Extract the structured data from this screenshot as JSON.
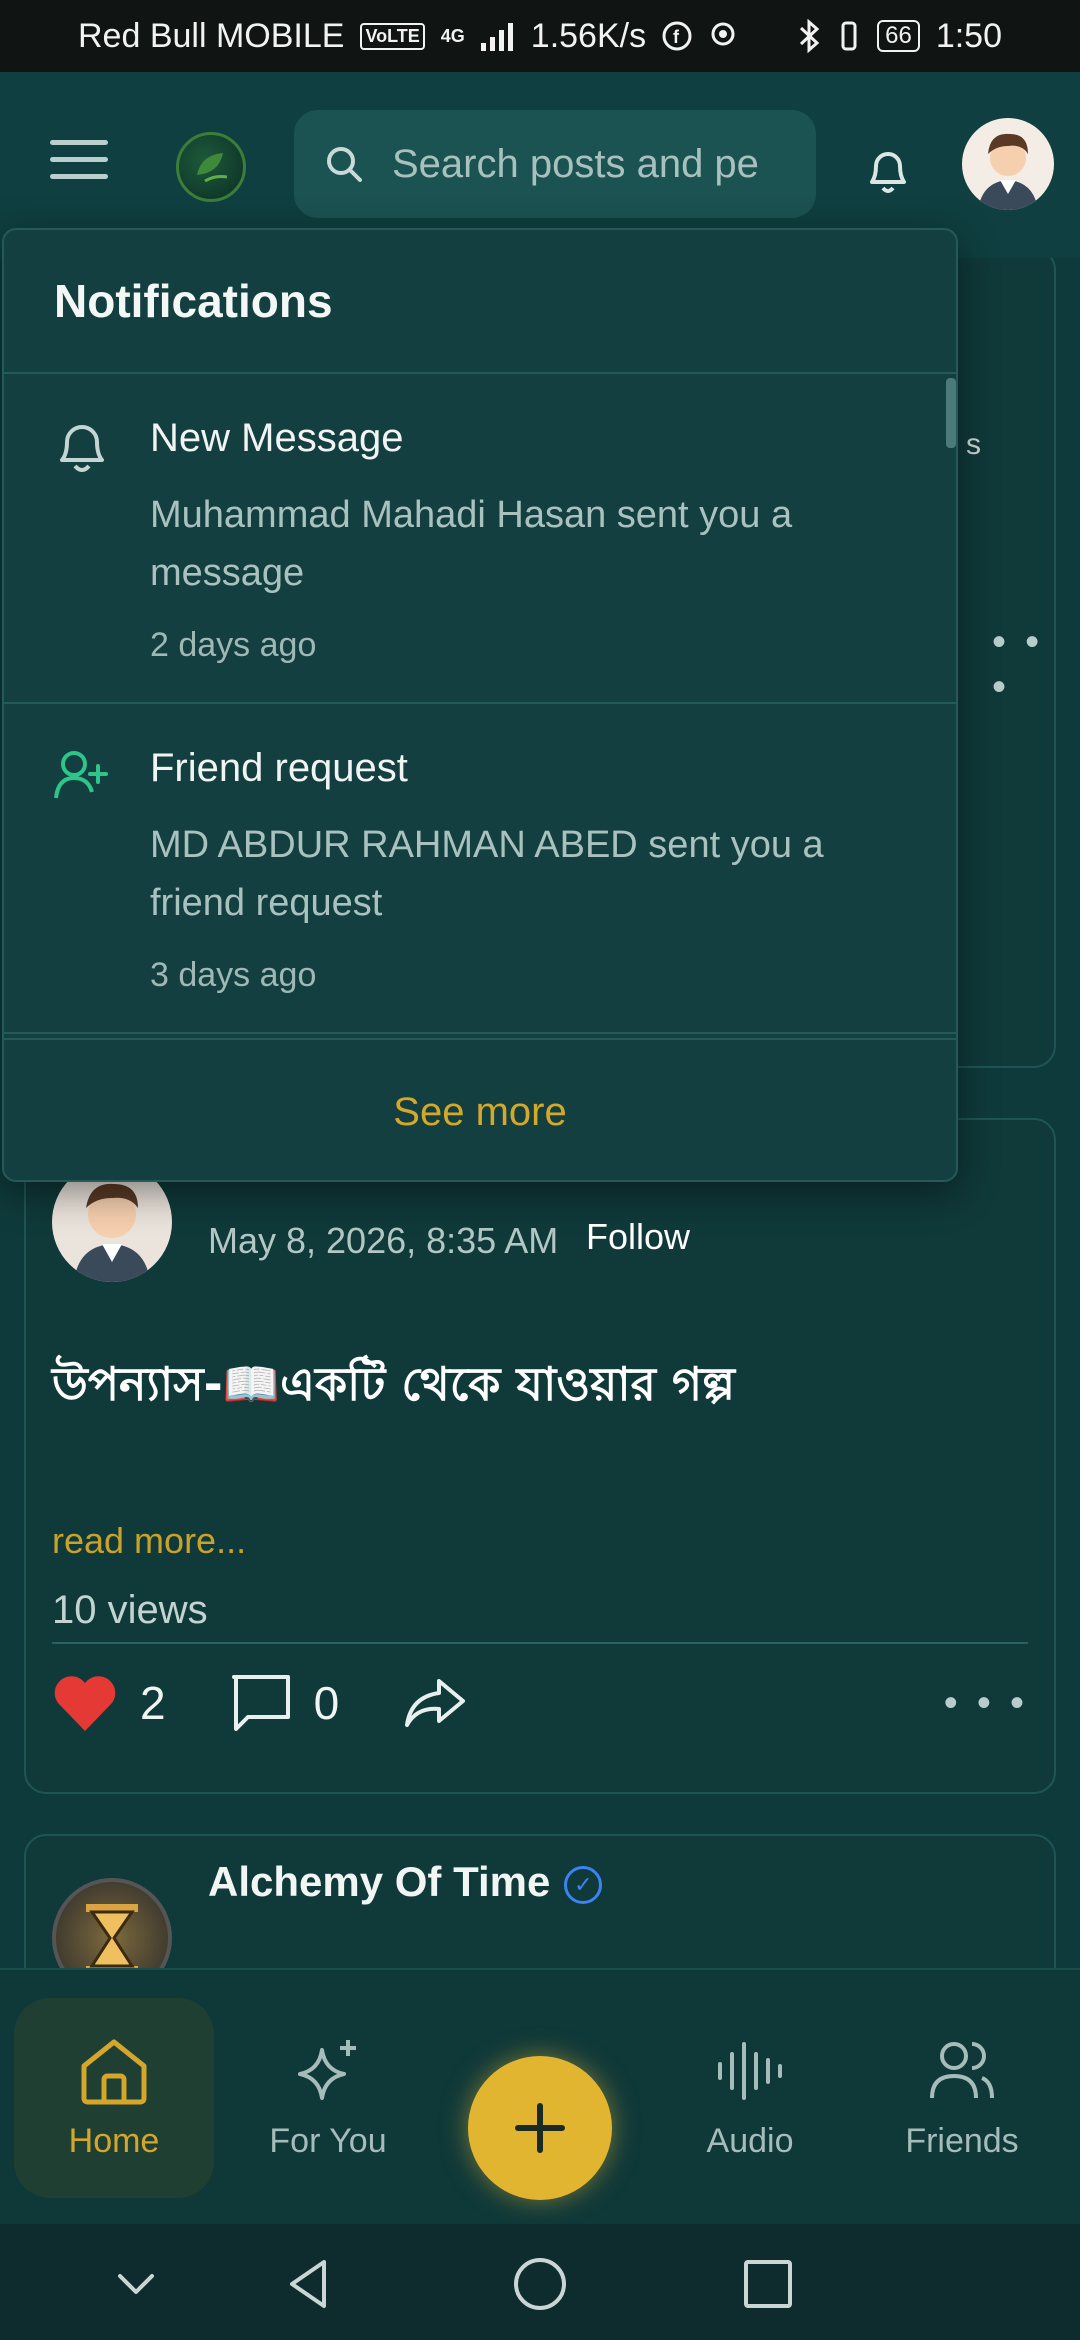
{
  "status_bar": {
    "carrier": "Red Bull MOBILE",
    "volte": "VoLTE",
    "network": "4G",
    "speed": "1.56K/s",
    "battery": "66",
    "time": "1:50"
  },
  "header": {
    "search_placeholder": "Search posts and pe"
  },
  "notifications": {
    "title": "Notifications",
    "items": [
      {
        "icon": "bell-icon",
        "title": "New Message",
        "body": "Muhammad Mahadi Hasan sent you a message",
        "time": "2 days ago"
      },
      {
        "icon": "user-plus-icon",
        "title": "Friend request",
        "body": "MD ABDUR RAHMAN ABED sent you a friend request",
        "time": "3 days ago"
      }
    ],
    "see_more": "See more"
  },
  "feed": {
    "peek_text": "s",
    "post": {
      "date": "May 8, 2026, 8:35 AM",
      "follow": "Follow",
      "title": "উপন্যাস-📖একটি থেকে যাওয়ার গল্প",
      "read_more": "read more...",
      "views": "10 views",
      "likes": "2",
      "comments": "0"
    },
    "next_post": {
      "author": "Alchemy Of Time"
    }
  },
  "bottom_nav": {
    "items": [
      {
        "label": "Home",
        "icon": "home-icon",
        "active": true
      },
      {
        "label": "For You",
        "icon": "sparkles-icon",
        "active": false
      },
      {
        "label": "Audio",
        "icon": "audio-wave-icon",
        "active": false
      },
      {
        "label": "Friends",
        "icon": "users-icon",
        "active": false
      }
    ]
  },
  "colors": {
    "background": "#0f3a3b",
    "accent": "#e1b52f",
    "like": "#e53935",
    "verified": "#3b82f6"
  }
}
